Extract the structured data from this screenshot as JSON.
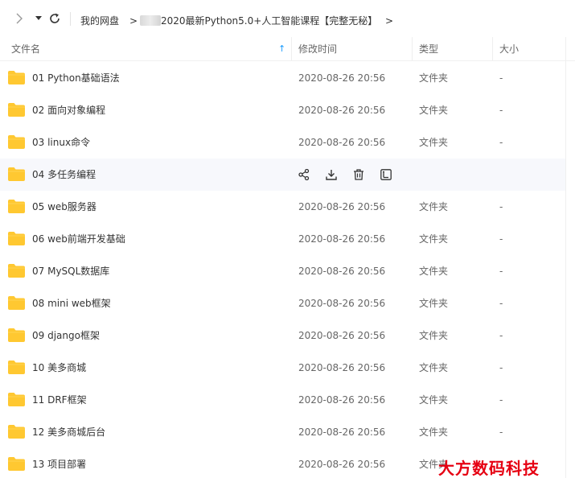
{
  "breadcrumb": {
    "root": "我的网盘",
    "separator": ">",
    "current": "2020最新Python5.0+人工智能课程【完整无秘】"
  },
  "header": {
    "name": "文件名",
    "sort_arrow": "↑",
    "modified": "修改时间",
    "type": "类型",
    "size": "大小"
  },
  "files": [
    {
      "name": "01 Python基础语法",
      "time": "2020-08-26 20:56",
      "type": "文件夹",
      "size": "-"
    },
    {
      "name": "02 面向对象编程",
      "time": "2020-08-26 20:56",
      "type": "文件夹",
      "size": "-"
    },
    {
      "name": "03 linux命令",
      "time": "2020-08-26 20:56",
      "type": "文件夹",
      "size": "-"
    },
    {
      "name": "04 多任务编程",
      "time": "",
      "type": "",
      "size": ""
    },
    {
      "name": "05 web服务器",
      "time": "2020-08-26 20:56",
      "type": "文件夹",
      "size": "-"
    },
    {
      "name": "06 web前端开发基础",
      "time": "2020-08-26 20:56",
      "type": "文件夹",
      "size": "-"
    },
    {
      "name": "07 MySQL数据库",
      "time": "2020-08-26 20:56",
      "type": "文件夹",
      "size": "-"
    },
    {
      "name": "08 mini web框架",
      "time": "2020-08-26 20:56",
      "type": "文件夹",
      "size": "-"
    },
    {
      "name": "09 django框架",
      "time": "2020-08-26 20:56",
      "type": "文件夹",
      "size": "-"
    },
    {
      "name": "10 美多商城",
      "time": "2020-08-26 20:56",
      "type": "文件夹",
      "size": "-"
    },
    {
      "name": "11 DRF框架",
      "time": "2020-08-26 20:56",
      "type": "文件夹",
      "size": "-"
    },
    {
      "name": "12 美多商城后台",
      "time": "2020-08-26 20:56",
      "type": "文件夹",
      "size": "-"
    },
    {
      "name": "13 项目部署",
      "time": "2020-08-26 20:56",
      "type": "文件夹",
      "size": "-"
    }
  ],
  "hovered_row_actions": [
    "share-icon",
    "download-icon",
    "delete-icon",
    "rename-icon"
  ],
  "watermark": "大方数码科技",
  "colors": {
    "folder": "#ffc831",
    "accent": "#1a9bfd",
    "watermark": "#e60012",
    "hover_row": "#f7f8fc"
  }
}
